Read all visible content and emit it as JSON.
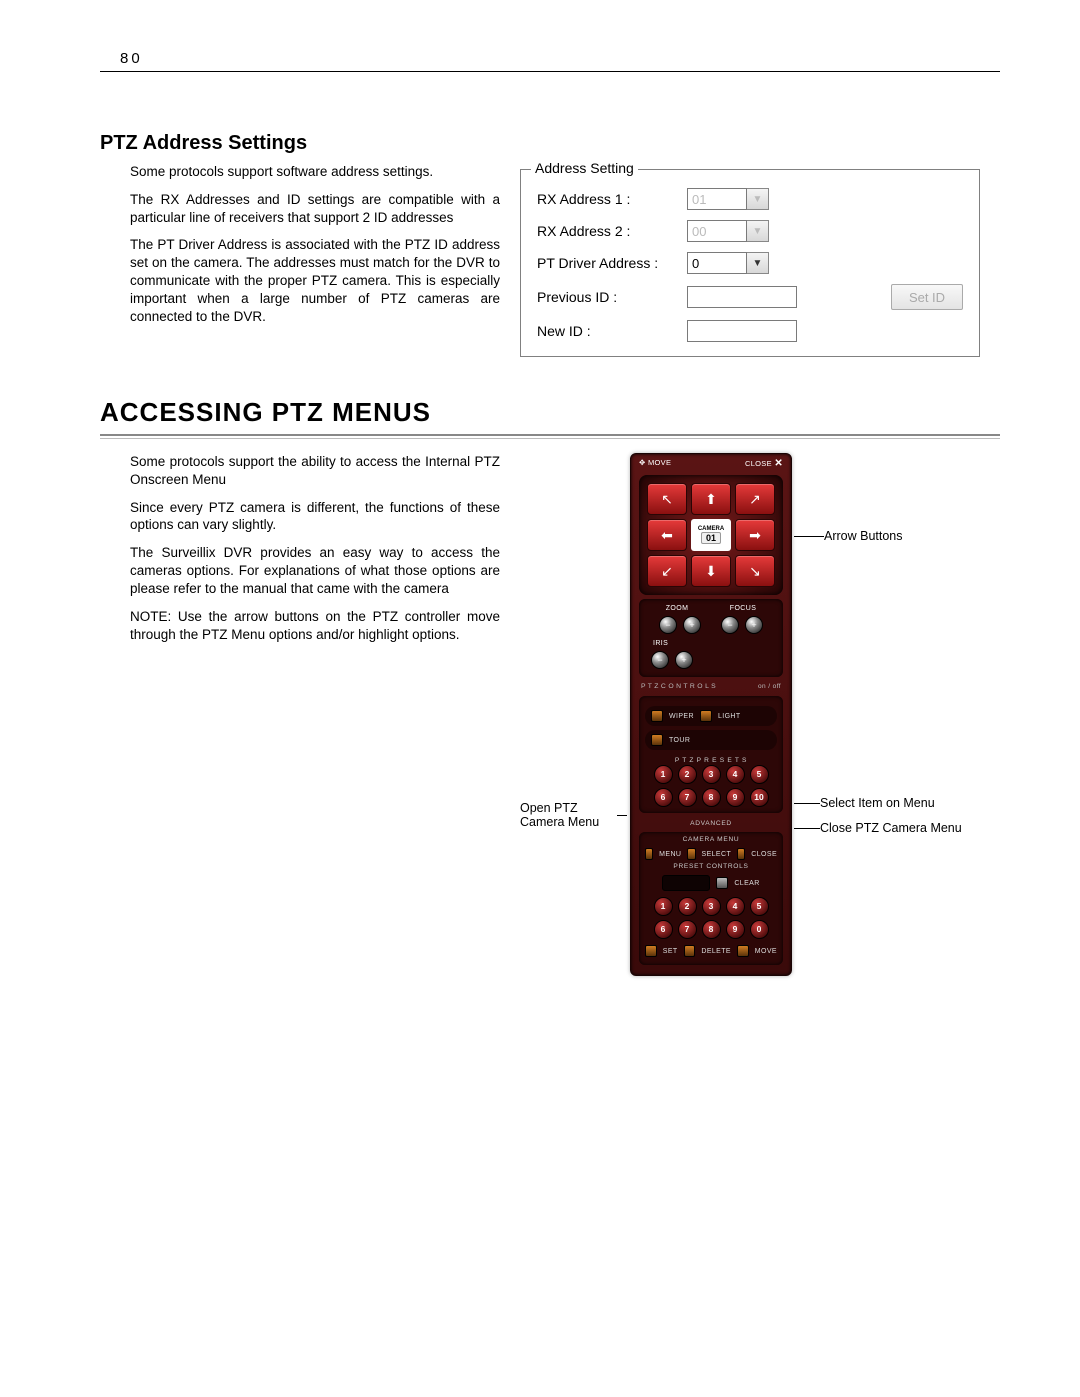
{
  "page": {
    "number": "80"
  },
  "section1": {
    "title": "PTZ Address Settings",
    "p1": "Some protocols support software address settings.",
    "p2": "The RX Addresses and ID settings are compatible with a particular line of receivers that support 2 ID addresses",
    "p3": "The PT Driver Address is associated with the PTZ ID address set on the camera.  The addresses must match for the DVR to communicate with the proper PTZ camera.  This is especially important when a large number of PTZ cameras are connected to the DVR."
  },
  "address_panel": {
    "legend": "Address Setting",
    "rx1_label": "RX Address 1 :",
    "rx1_value": "01",
    "rx2_label": "RX Address 2 :",
    "rx2_value": "00",
    "pt_label": "PT Driver Address  :",
    "pt_value": "0",
    "prev_label": "Previous ID :",
    "new_label": "New ID :",
    "button": "Set ID"
  },
  "section2": {
    "title": "ACCESSING PTZ MENUS",
    "p1": "Some protocols support the ability to access the Internal PTZ Onscreen Menu",
    "p2": "Since every PTZ camera is different, the functions of these options can vary slightly.",
    "p3": "The Surveillix DVR provides an easy way to access the cameras options. For explanations of what those options are please refer to the manual that came with the camera",
    "p4": "NOTE: Use the arrow buttons on the PTZ controller move through the PTZ Menu options and/or highlight options."
  },
  "controller": {
    "move": "MOVE",
    "close": "CLOSE",
    "camera_label": "CAMERA",
    "camera_num": "01",
    "zoom": "ZOOM",
    "focus": "FOCUS",
    "iris": "IRIS",
    "ptz_ctrls": "P T Z  C O N T R O L S",
    "onoff": "on / off",
    "wiper": "WIPER",
    "light": "LIGHT",
    "tour": "TOUR",
    "presets_title": "P T Z   P R E S E T S",
    "presets1": [
      "1",
      "2",
      "3",
      "4",
      "5"
    ],
    "presets2": [
      "6",
      "7",
      "8",
      "9",
      "10"
    ],
    "advanced": "ADVANCED",
    "camera_menu": "CAMERA MENU",
    "menu_btn": "MENU",
    "select_btn": "SELECT",
    "close_btn": "CLOSE",
    "preset_ctrls": "PRESET CONTROLS",
    "clear": "CLEAR",
    "kp1": [
      "1",
      "2",
      "3",
      "4",
      "5"
    ],
    "kp2": [
      "6",
      "7",
      "8",
      "9",
      "0"
    ],
    "set": "SET",
    "delete": "DELETE",
    "move2": "MOVE"
  },
  "callouts": {
    "arrows": "Arrow Buttons",
    "open": "Open PTZ Camera Menu",
    "select": "Select Item on Menu",
    "close": "Close PTZ Camera Menu"
  }
}
